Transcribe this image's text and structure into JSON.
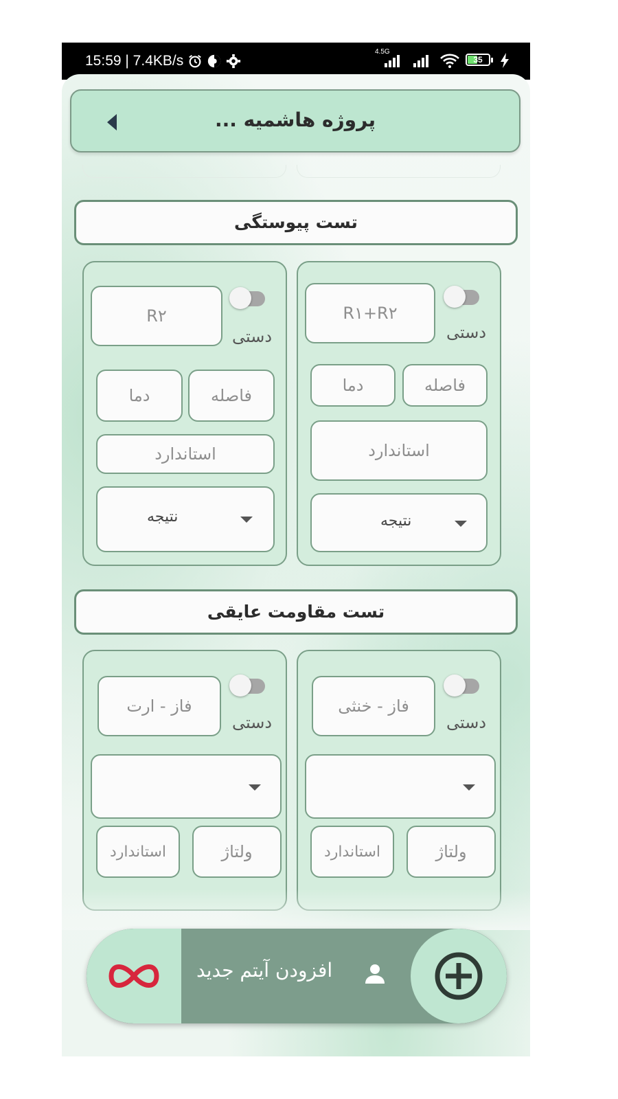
{
  "status_bar": {
    "time_speed": "15:59 | 7.4KB/s",
    "network_badge": "4.5G",
    "battery": "35"
  },
  "header": {
    "title": "پروژه هاشمیه ..."
  },
  "sections": [
    {
      "title": "تست پیوستگی",
      "cards": [
        {
          "toggle_label": "دستی",
          "main_field": "R۱+R۲",
          "field_a": "فاصله",
          "field_b": "دما",
          "standard": "استاندارد",
          "result": "نتیجه"
        },
        {
          "toggle_label": "دستی",
          "main_field": "R۲",
          "field_a": "فاصله",
          "field_b": "دما",
          "standard": "استاندارد",
          "result": "نتیجه"
        }
      ]
    },
    {
      "title": "تست مقاومت عایقی",
      "cards": [
        {
          "toggle_label": "دستی",
          "main_field": "فاز - خنثی",
          "dropdown_value": "",
          "voltage": "ولتاژ",
          "standard": "استاندارد"
        },
        {
          "toggle_label": "دستی",
          "main_field": "فاز - ارت",
          "dropdown_value": "",
          "voltage": "ولتاژ",
          "standard": "استاندارد"
        }
      ]
    }
  ],
  "bottom_bar": {
    "add_label": "افزودن آیتم جدید"
  },
  "colors": {
    "header_bg": "#bde6d0",
    "card_bg": "#d4eddd",
    "border": "#7a9f88",
    "bottom_bar": "#7d9d8c",
    "logo_red": "#d7263d"
  }
}
